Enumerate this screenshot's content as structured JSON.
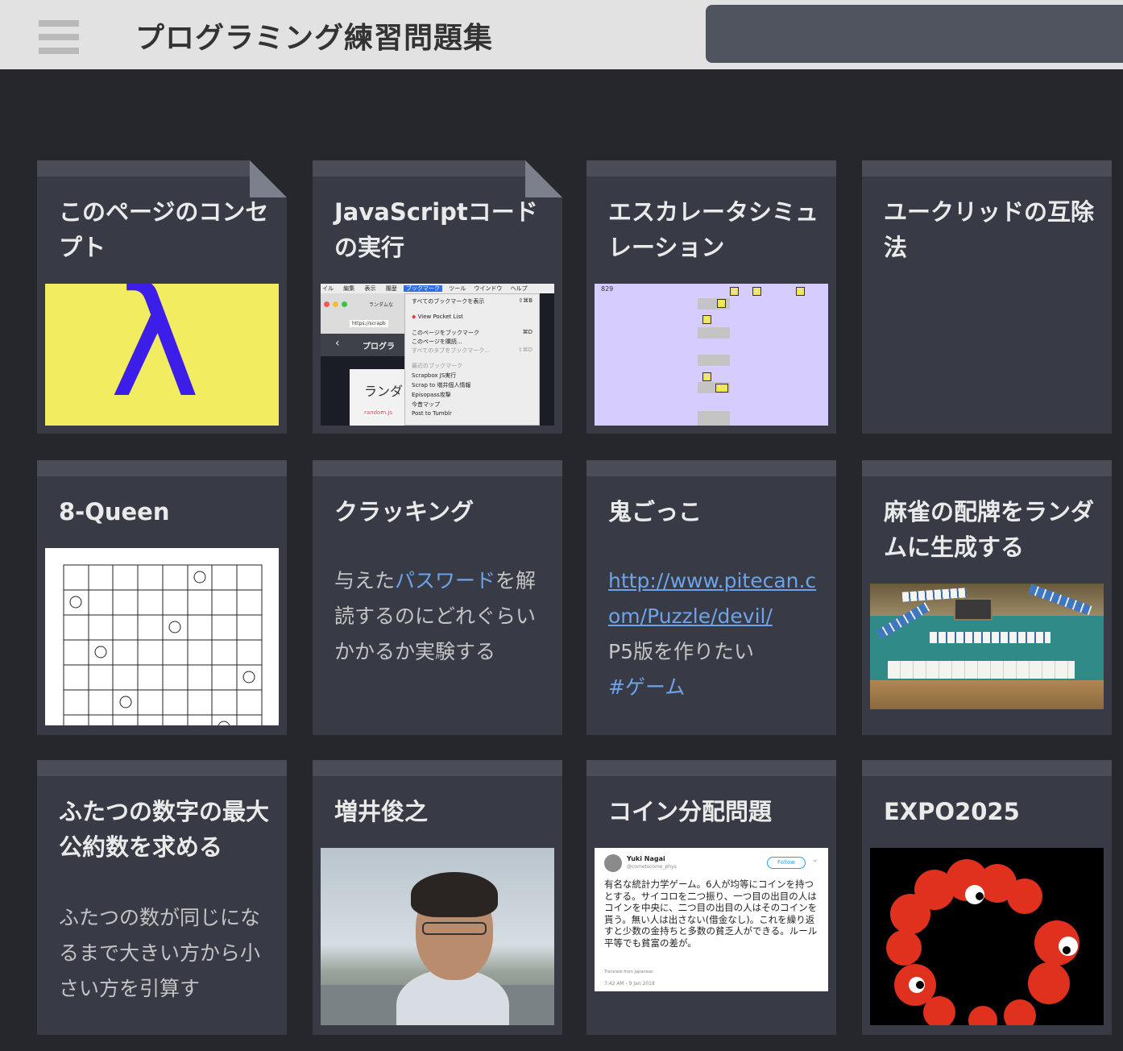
{
  "header": {
    "menu_icon": "hamburger-icon",
    "project_title": "プログラミング練習問題集",
    "search_placeholder": ""
  },
  "cards": [
    {
      "title": "このページのコンセプト",
      "thumb": "lambda-image",
      "lambda": "λ"
    },
    {
      "title": "JavaScriptコードの実行",
      "thumb": "browser-screenshot",
      "menu_bar": [
        "イル",
        "編集",
        "表示",
        "履歴",
        "ブックマーク",
        "ツール",
        "ウインドウ",
        "ヘルプ"
      ],
      "dropdown": [
        {
          "label": "すべてのブックマークを表示",
          "key": "⇧⌘B"
        },
        {
          "label": "View Pocket List",
          "key": ""
        },
        {
          "label": "このページをブックマーク",
          "key": "⌘D"
        },
        {
          "label": "このページを購読...",
          "key": ""
        },
        {
          "label": "すべてのタブをブックマーク...",
          "key": "⇧⌘D"
        },
        {
          "label": "最近のブックマーク",
          "key": ""
        },
        {
          "label": "Scrapbox JS実行",
          "key": ""
        },
        {
          "label": "Scrap to 増井個人情報",
          "key": ""
        },
        {
          "label": "Episopass攻撃",
          "key": ""
        },
        {
          "label": "今昔マップ",
          "key": ""
        },
        {
          "label": "Post to Tumblr",
          "key": ""
        }
      ],
      "tab_label": "ランダムな",
      "url_text": "https://scrapb",
      "page_label": "プログラ",
      "page_text": "ランダ",
      "file_label": "random.js"
    },
    {
      "title": "エスカレータシミュレーション",
      "thumb": "escalator-sim",
      "counter": "829",
      "numbers": [
        "4",
        "6",
        "3",
        "7",
        "5",
        "8",
        "10"
      ]
    },
    {
      "title": "ユークリッドの互除法",
      "thumb": ""
    },
    {
      "title": "8-Queen",
      "thumb": "queen-board"
    },
    {
      "title": "クラッキング",
      "desc_pre": "与えた",
      "desc_link": "パスワード",
      "desc_post": "を解読するのにどれぐらいかかるか実験する"
    },
    {
      "title": "鬼ごっこ",
      "desc_url": "http://www.pitecan.com/Puzzle/devil/",
      "desc_text": "P5版を作りたい",
      "desc_tag": "#ゲーム"
    },
    {
      "title": "麻雀の配牌をランダムに生成する",
      "thumb": "mahjong-photo"
    },
    {
      "title": "ふたつの数字の最大公約数を求める",
      "desc": "ふたつの数が同じになるまで大きい方から小さい方を引算す"
    },
    {
      "title": "増井俊之",
      "thumb": "portrait-photo"
    },
    {
      "title": "コイン分配問題",
      "thumb": "tweet-screenshot",
      "tweet": {
        "name": "Yuki Nagai",
        "handle": "@cometscome_phys",
        "follow": "Follow",
        "text": "有名な統計力学ゲーム。6人が均等にコインを持つとする。サイコロを二つ振り、一つ目の出目の人はコインを中央に、二つ目の出目の人はそのコインを貰う。無い人は出さない(借金なし)。これを繰り返すと少数の金持ちと多数の貧乏人ができる。ルール平等でも貧富の差が。",
        "translate": "Translate from Japanese",
        "date": "7:42 AM - 9 Jan 2018"
      }
    },
    {
      "title": "EXPO2025",
      "thumb": "expo-logo"
    }
  ]
}
